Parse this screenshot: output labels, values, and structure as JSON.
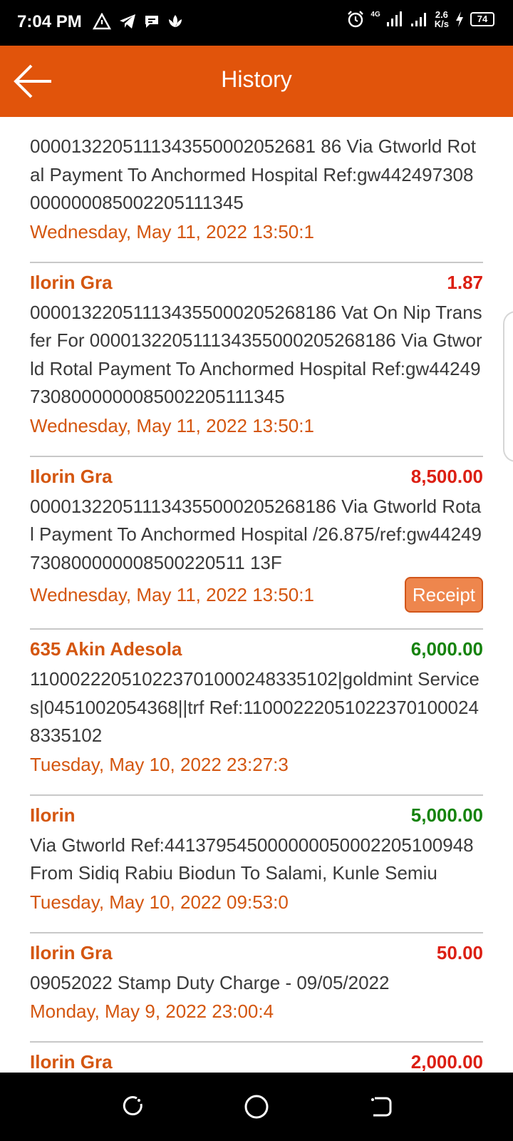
{
  "status_bar": {
    "time": "7:04 PM",
    "network_type": "4G",
    "speed_value": "2.6",
    "speed_unit": "K/s",
    "battery": "74"
  },
  "app_bar": {
    "title": "History"
  },
  "transactions": [
    {
      "name": "",
      "amount": "",
      "amount_type": "debit",
      "description": "0000132205111343550002052681 86 Via Gtworld Rotal Payment To Anchormed Hospital Ref:gw442497308000000085002205111345",
      "date": "Wednesday, May 11, 2022 13:50:1"
    },
    {
      "name": "Ilorin Gra",
      "amount": "1.87",
      "amount_type": "debit",
      "description": "000013220511134355000205268186 Vat On Nip Transfer For 000013220511134355000205268186 Via Gtworld Rotal Payment To Anchormed Hospital Ref:gw442497308000000085002205111345",
      "date": "Wednesday, May 11, 2022 13:50:1"
    },
    {
      "name": "Ilorin Gra",
      "amount": "8,500.00",
      "amount_type": "debit",
      "description": "000013220511134355000205268186 Via Gtworld Rotal Payment To Anchormed Hospital /26.875/ref:gw44249730800000008500220511 13F",
      "date": "Wednesday, May 11, 2022 13:50:1",
      "receipt_label": "Receipt"
    },
    {
      "name": "635 Akin Adesola",
      "amount": "6,000.00",
      "amount_type": "credit",
      "description": "110002220510223701000248335102|goldmint Services|0451002054368||trf Ref:110002220510223701000248335102",
      "date": "Tuesday, May 10, 2022 23:27:3"
    },
    {
      "name": "Ilorin",
      "amount": "5,000.00",
      "amount_type": "credit",
      "description": "Via Gtworld Ref:441379545000000050002205100948 From Sidiq Rabiu Biodun To Salami, Kunle Semiu",
      "date": "Tuesday, May 10, 2022 09:53:0"
    },
    {
      "name": "Ilorin Gra",
      "amount": "50.00",
      "amount_type": "debit",
      "description": "09052022 Stamp Duty Charge - 09/05/2022",
      "date": "Monday, May 9, 2022 23:00:4"
    },
    {
      "name": "Ilorin Gra",
      "amount": "2,000.00",
      "amount_type": "debit",
      "description": "",
      "date": ""
    }
  ],
  "colors": {
    "brand": "#E1540B",
    "debit": "#DC1F13",
    "credit": "#16830D"
  }
}
